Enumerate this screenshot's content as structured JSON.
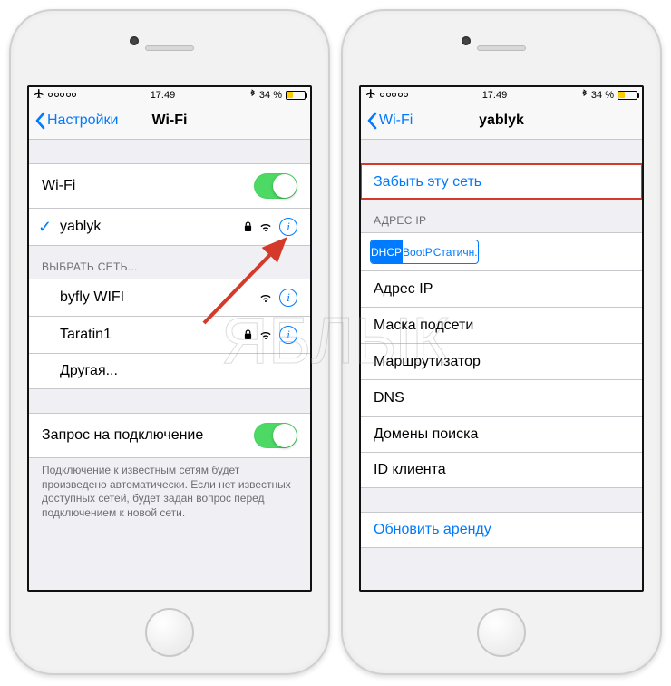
{
  "status": {
    "time": "17:49",
    "battery_percent": "34 %"
  },
  "left": {
    "back_label": "Настройки",
    "title": "Wi-Fi",
    "wifi_row_label": "Wi-Fi",
    "connected_network": "yablyk",
    "choose_header": "ВЫБРАТЬ СЕТЬ...",
    "networks": [
      {
        "name": "byfly WIFI",
        "secured": false
      },
      {
        "name": "Taratin1",
        "secured": true
      }
    ],
    "other_label": "Другая...",
    "ask_label": "Запрос на подключение",
    "ask_footer": "Подключение к известным сетям будет произведено автоматически. Если нет известных доступных сетей, будет задан вопрос перед подключением к новой сети."
  },
  "right": {
    "back_label": "Wi-Fi",
    "title": "yablyk",
    "forget_label": "Забыть эту сеть",
    "ip_header": "АДРЕС IP",
    "segments": [
      "DHCP",
      "BootP",
      "Статичн."
    ],
    "fields": [
      "Адрес IP",
      "Маска подсети",
      "Маршрутизатор",
      "DNS",
      "Домены поиска",
      "ID клиента"
    ],
    "renew_label": "Обновить аренду"
  },
  "watermark_text": "ЯБЛЫК"
}
